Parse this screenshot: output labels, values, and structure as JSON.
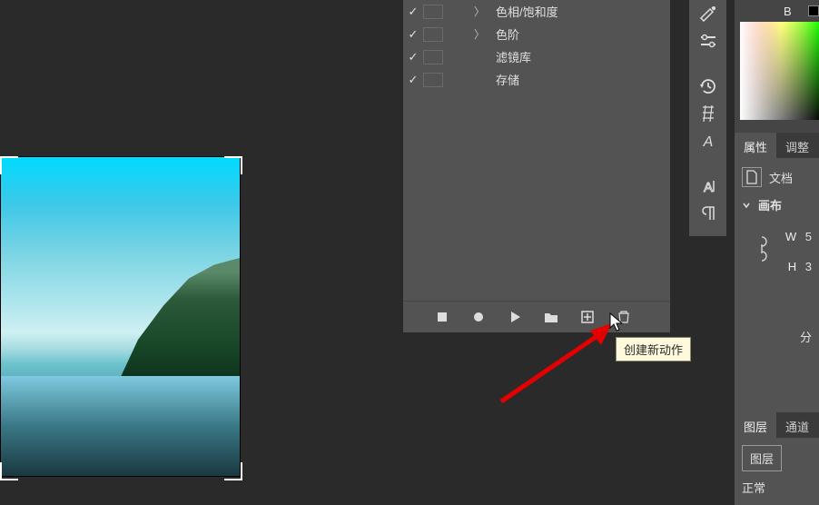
{
  "actions": {
    "rows": [
      {
        "checked": true,
        "expand": "〉",
        "label": "色相/饱和度"
      },
      {
        "checked": true,
        "expand": "〉",
        "label": "色阶"
      },
      {
        "checked": true,
        "expand": "",
        "label": "滤镜库"
      },
      {
        "checked": true,
        "expand": "",
        "label": "存储"
      }
    ],
    "toolbar": {
      "stop": "停止",
      "record": "记录",
      "play": "播放",
      "new_set": "创建新组",
      "new_action": "创建新动作",
      "delete": "删除"
    },
    "tooltip": "创建新动作"
  },
  "right_tools": {
    "brush": "brush",
    "sliders": "sliders",
    "history": "history",
    "type_hash": "type-hash",
    "type_a": "type-a",
    "type_ao": "type-a-outline",
    "paragraph": "paragraph"
  },
  "right_rail": {
    "b_label": "B",
    "tabs": {
      "props": "属性",
      "adjust": "调整"
    },
    "doc_label": "文档",
    "canvas_label": "画布",
    "W": "W",
    "H": "H",
    "W_val": "5",
    "H_val": "3",
    "split": "分",
    "layers_tabs": {
      "layers": "图层",
      "channels": "通道"
    },
    "layers_body": {
      "layer_label": "图层",
      "blend": "正常"
    }
  }
}
